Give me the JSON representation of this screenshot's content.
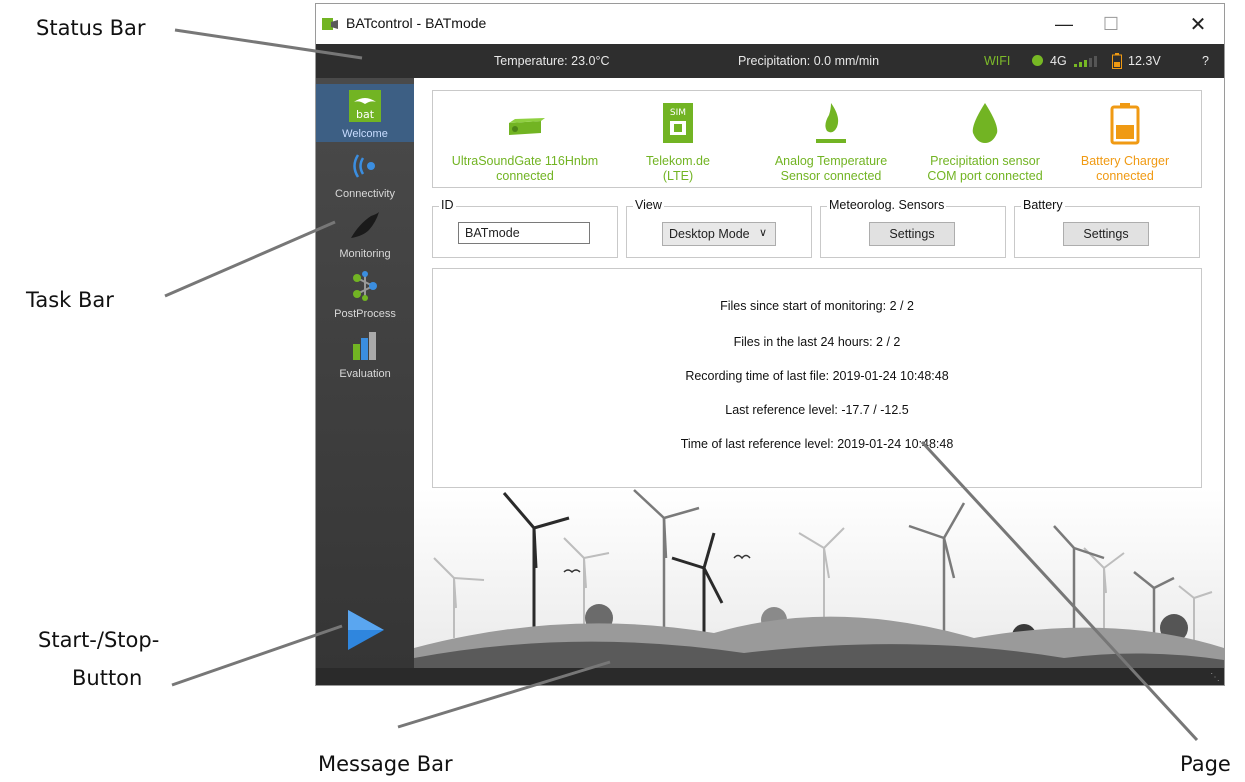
{
  "annotations": {
    "status_bar": "Status Bar",
    "task_bar": "Task Bar",
    "start_stop_line1": "Start-/Stop-",
    "start_stop_line2": "Button",
    "message_bar": "Message Bar",
    "page": "Page"
  },
  "window": {
    "title": "BATcontrol - BATmode",
    "minimize_icon": "minimize-icon",
    "maximize_icon": "maximize-icon",
    "close_icon": "close-icon"
  },
  "statusbar": {
    "temperature": "Temperature: 23.0°C",
    "precipitation": "Precipitation: 0.0 mm/min",
    "wifi": "WIFI",
    "network": "4G",
    "voltage": "12.3V",
    "help": "?"
  },
  "taskbar": {
    "items": [
      {
        "label": "Welcome",
        "icon": "bat-logo-icon",
        "active": true
      },
      {
        "label": "Connectivity",
        "icon": "wireless-icon"
      },
      {
        "label": "Monitoring",
        "icon": "bat-silhouette-icon"
      },
      {
        "label": "PostProcess",
        "icon": "molecule-icon"
      },
      {
        "label": "Evaluation",
        "icon": "bar-chart-icon"
      }
    ],
    "start_button_icon": "play-icon"
  },
  "devices": [
    {
      "line1": "UltraSoundGate 116Hnbm",
      "line2": "connected",
      "icon": "usb-device-icon",
      "status_color": "#72b423"
    },
    {
      "line1": "Telekom.de",
      "line2": "(LTE)",
      "icon": "sim-card-icon",
      "status_color": "#72b423"
    },
    {
      "line1": "Analog Temperature",
      "line2": "Sensor connected",
      "icon": "temperature-sensor-icon",
      "status_color": "#72b423"
    },
    {
      "line1": "Precipitation sensor",
      "line2": "COM port connected",
      "icon": "rain-drop-icon",
      "status_color": "#72b423"
    },
    {
      "line1": "Battery Charger",
      "line2": "connected",
      "icon": "battery-icon",
      "status_color": "#f09a13"
    }
  ],
  "settings": {
    "id_label": "ID",
    "id_value": "BATmode",
    "view_label": "View",
    "view_value": "Desktop Mode",
    "meteo_label": "Meteorolog. Sensors",
    "meteo_button": "Settings",
    "battery_label": "Battery",
    "battery_button": "Settings"
  },
  "info": {
    "files_since_start": "Files since start of monitoring: 2 / 2",
    "files_last_24h": "Files in the last 24 hours: 2 / 2",
    "recording_time": "Recording time of last file: 2019-01-24 10:48:48",
    "reference_level": "Last reference level: -17.7 / -12.5",
    "reference_time": "Time of last reference level: 2019-01-24 10:48:48"
  }
}
